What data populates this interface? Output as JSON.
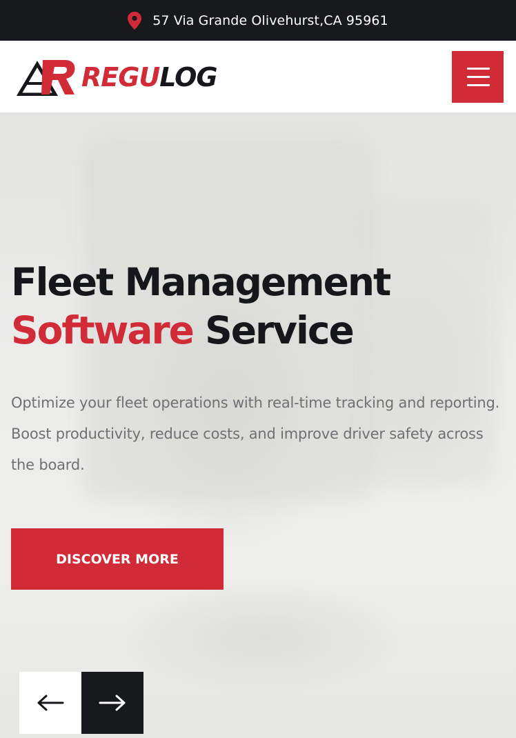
{
  "topbar": {
    "icon": "location-pin-icon",
    "address": "57 Via Grande Olivehurst,CA 95961"
  },
  "header": {
    "logo": {
      "word_red": "REGU",
      "word_black": "LOG"
    },
    "menu_icon": "hamburger-menu-icon"
  },
  "hero": {
    "title_line1": "Fleet Management",
    "title_accent": "Software",
    "title_rest": " Service",
    "description": "Optimize your fleet operations with real-time tracking and reporting. Boost productivity, reduce costs, and improve driver safety across the board.",
    "cta_label": "DISCOVER MORE",
    "prev_icon": "arrow-left-icon",
    "next_icon": "arrow-right-icon"
  },
  "colors": {
    "accent": "#d12b38",
    "dark": "#18191c",
    "text_muted": "#6f7074"
  }
}
